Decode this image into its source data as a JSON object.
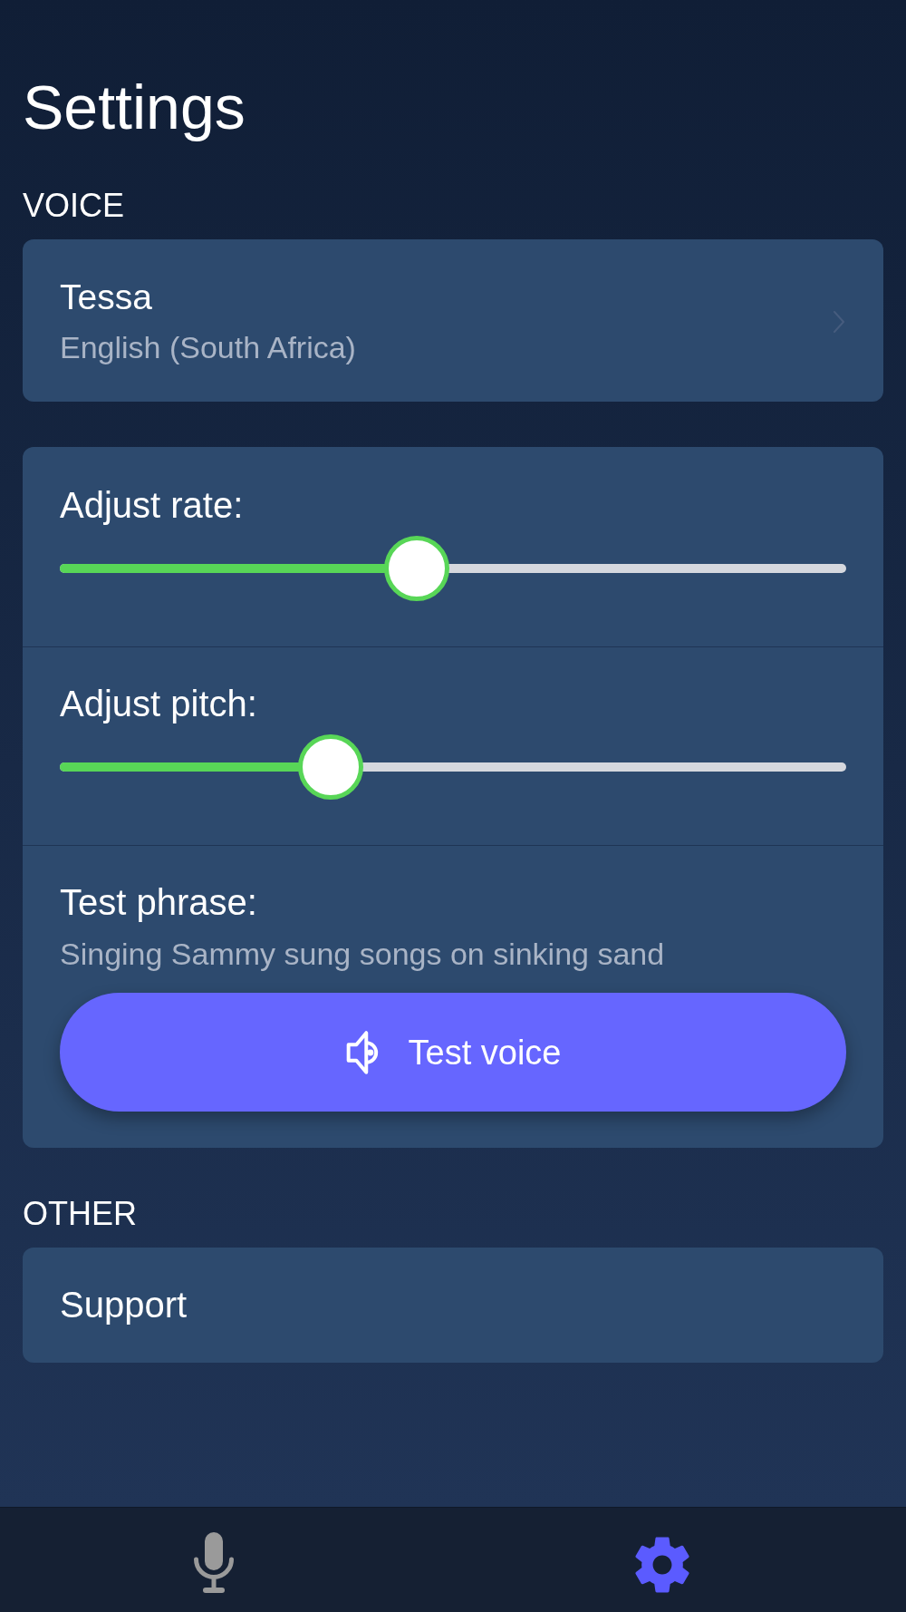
{
  "header": {
    "title": "Settings"
  },
  "voice_section": {
    "heading": "VOICE",
    "voice": {
      "name": "Tessa",
      "language": "English (South Africa)"
    },
    "controls": [
      {
        "kind": "slider",
        "label": "Adjust rate:",
        "level": 0.45
      },
      {
        "kind": "slider",
        "label": "Adjust pitch:",
        "level": 0.33
      },
      {
        "kind": "phrase",
        "label": "Test phrase:",
        "phrase": "Singing Sammy sung songs on sinking sand",
        "button": "Test voice"
      }
    ]
  },
  "other_section": {
    "heading": "OTHER",
    "items": [
      {
        "label": "Support"
      }
    ]
  },
  "tab_bar": {
    "tabs": [
      {
        "kind": "record",
        "selected": false
      },
      {
        "kind": "settings",
        "selected": true
      }
    ]
  }
}
